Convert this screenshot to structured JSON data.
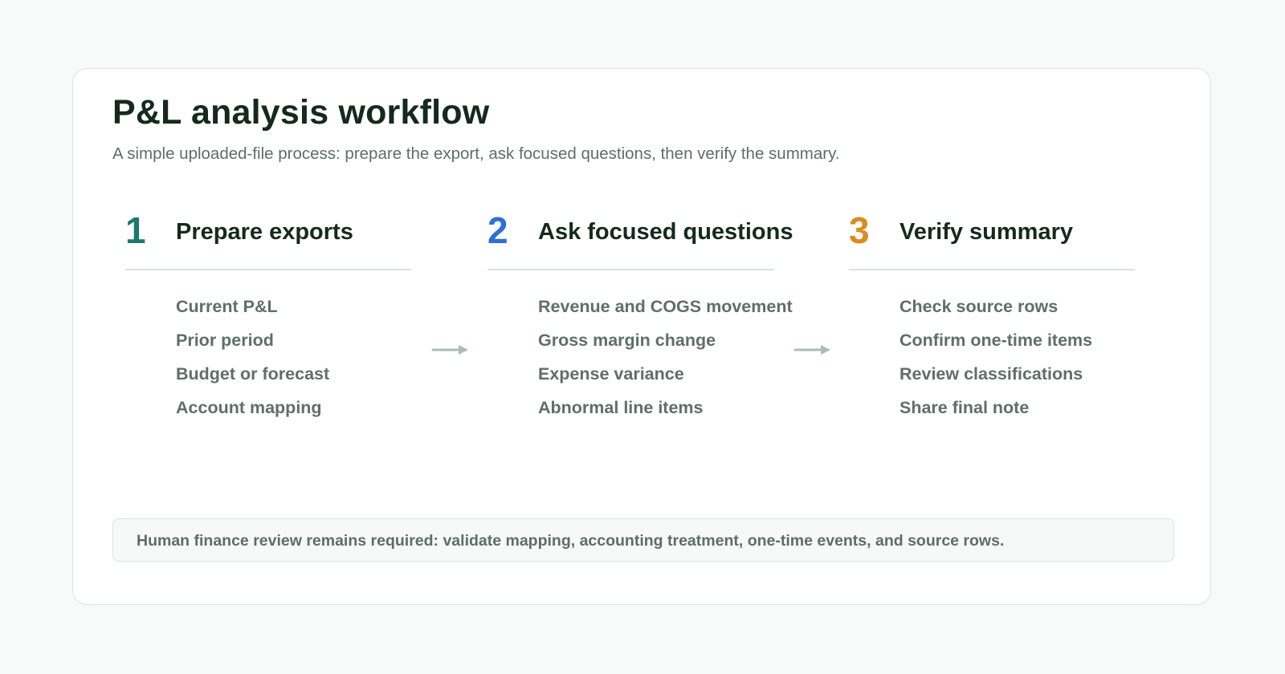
{
  "header": {
    "title": "P&L analysis workflow",
    "subtitle": "A simple uploaded-file process: prepare the export, ask focused questions, then verify the summary."
  },
  "steps": [
    {
      "number": "1",
      "title": "Prepare exports",
      "color": "#1a7a6c",
      "items": [
        "Current P&L",
        "Prior period",
        "Budget or forecast",
        "Account mapping"
      ]
    },
    {
      "number": "2",
      "title": "Ask focused questions",
      "color": "#2f6fd6",
      "items": [
        "Revenue and COGS movement",
        "Gross margin change",
        "Expense variance",
        "Abnormal line items"
      ]
    },
    {
      "number": "3",
      "title": "Verify summary",
      "color": "#d98c1f",
      "items": [
        "Check source rows",
        "Confirm one-time items",
        "Review classifications",
        "Share final note"
      ]
    }
  ],
  "arrows": {
    "icon": "arrow-right-icon",
    "color": "#a9bdb7"
  },
  "notice": {
    "text": "Human finance review remains required: validate mapping, accounting treatment, one-time events, and source rows."
  }
}
